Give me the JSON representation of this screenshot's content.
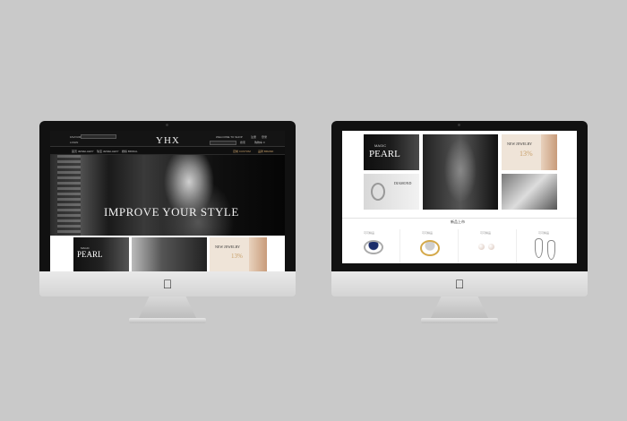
{
  "left_site": {
    "logo": "YHX",
    "top_left_links": [
      "FAVOURITE",
      "LOGIN"
    ],
    "nav_items": [
      "首页 JEWELLERY",
      "珠宝 JEWELLERY",
      "婚嫁 BRIDAL",
      "定制 CUSTOM",
      "品牌 BRAND"
    ],
    "top_right_links": [
      "WELCOME TO SHOP",
      "注册",
      "登录"
    ],
    "search_button": "搜索",
    "cart_label": "购物车 0",
    "hero_headline": "IMPROVE YOUR STYLE",
    "tiles": {
      "magic_pearl_small": "MAGIC",
      "magic_pearl_big": "PEARL",
      "new_jewelry": "NEW JEWELRY",
      "discount": "13%"
    }
  },
  "right_site": {
    "tiles": {
      "magic_small": "MAGIC",
      "pearl": "PEARL",
      "new_jewelry": "NEW JEWELRY",
      "discount": "13%",
      "diamond": "DIAMOND"
    },
    "section_title": "新品上市",
    "product_labels": [
      "可可精品",
      "可可精品",
      "可可精品",
      "可可精品"
    ]
  },
  "colors": {
    "background": "#c9c9c9",
    "bezel": "#111111",
    "accent_gold": "#c8a06a"
  }
}
